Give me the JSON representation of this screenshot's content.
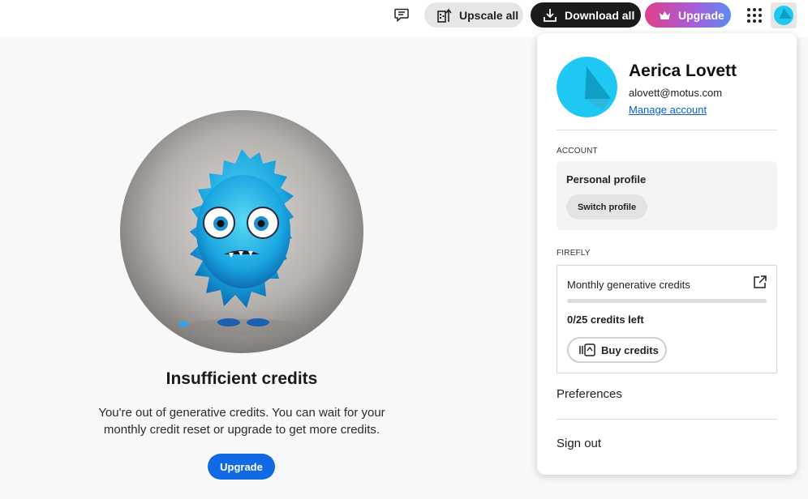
{
  "topbar": {
    "feedback_icon": "feedback-icon",
    "upscale_label": "Upscale all",
    "download_label": "Download all",
    "upgrade_label": "Upgrade",
    "apps_icon": "app-grid-icon",
    "colors": {
      "download_bg": "#1b1b1b",
      "upgrade_gradient_start": "#e0408a",
      "upgrade_gradient_end": "#5c8cf0"
    }
  },
  "main": {
    "headline": "Insufficient credits",
    "description": "You're out of generative credits. You can wait for your monthly credit reset or upgrade to get more credits.",
    "upgrade_label": "Upgrade",
    "accent": "#1169e3"
  },
  "account_panel": {
    "name": "Aerica Lovett",
    "email": "alovett@motus.com",
    "manage_label": "Manage account",
    "account_section": "ACCOUNT",
    "profile_title": "Personal profile",
    "switch_label": "Switch profile",
    "firefly_section": "FIREFLY",
    "credits_title": "Monthly generative credits",
    "credits_used_fraction": 0,
    "credits_left": "0/25 credits left",
    "buy_label": "Buy credits",
    "preferences_label": "Preferences",
    "signout_label": "Sign out"
  }
}
